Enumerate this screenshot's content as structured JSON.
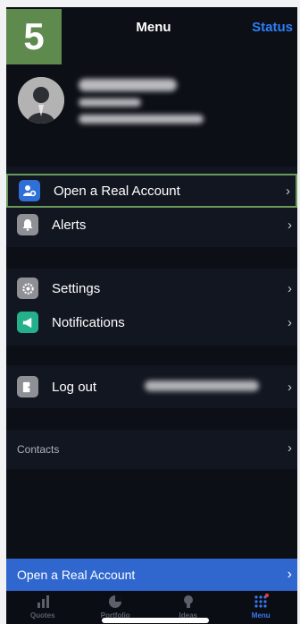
{
  "step_badge": "5",
  "header": {
    "title": "Menu",
    "status_link": "Status"
  },
  "menu": {
    "open_account": "Open a Real Account",
    "alerts": "Alerts",
    "settings": "Settings",
    "notifications": "Notifications",
    "logout": "Log out",
    "contacts": "Contacts"
  },
  "cta": {
    "label": "Open a Real Account"
  },
  "tabs": [
    {
      "label": "Quotes",
      "icon": "bar-chart-icon"
    },
    {
      "label": "Portfolio",
      "icon": "pie-chart-icon"
    },
    {
      "label": "Ideas",
      "icon": "lightbulb-icon"
    },
    {
      "label": "Menu",
      "icon": "grid-icon"
    }
  ],
  "colors": {
    "accent": "#2d7ff9",
    "cta": "#2f67cf",
    "highlight": "#6a9a5b",
    "badge": "#5f8a4e"
  }
}
